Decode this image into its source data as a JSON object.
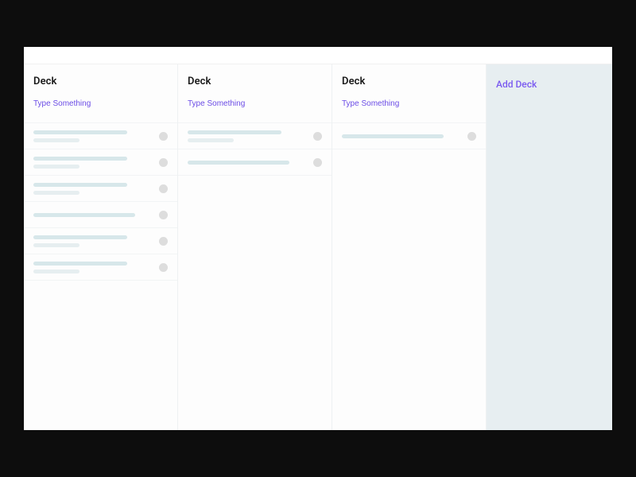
{
  "colors": {
    "accent": "#6b4ce6",
    "add_panel_bg": "#e7eef1",
    "placeholder_bar": "#d7e7ea"
  },
  "decks": [
    {
      "title": "Deck",
      "input_placeholder": "Type Something",
      "card_count": 6
    },
    {
      "title": "Deck",
      "input_placeholder": "Type Something",
      "card_count": 2
    },
    {
      "title": "Deck",
      "input_placeholder": "Type Something",
      "card_count": 1
    }
  ],
  "add_deck": {
    "label": "Add Deck"
  }
}
